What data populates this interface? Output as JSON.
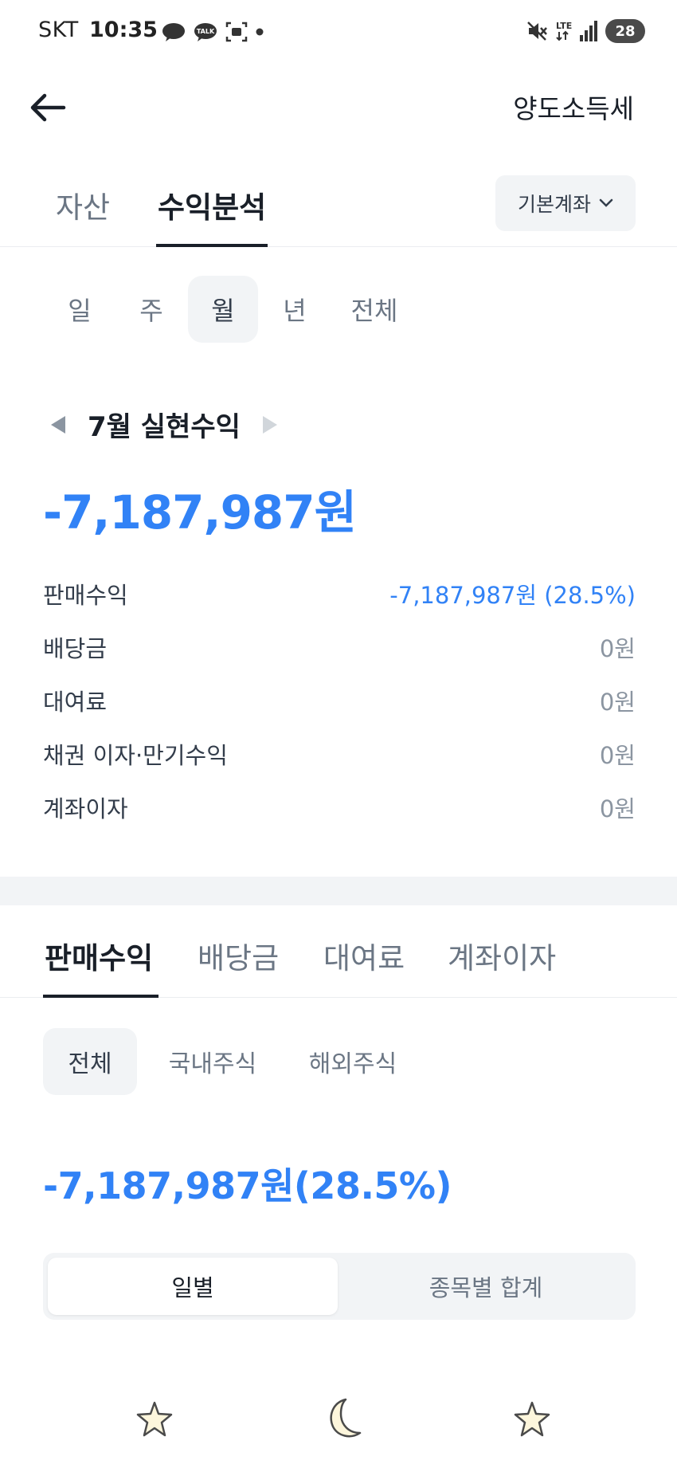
{
  "status_bar": {
    "carrier": "SKT",
    "time": "10:35",
    "battery": "28",
    "network": "LTE"
  },
  "header": {
    "title": "양도소득세"
  },
  "main_tabs": {
    "items": [
      {
        "label": "자산"
      },
      {
        "label": "수익분석"
      }
    ],
    "account_button": "기본계좌"
  },
  "period_tabs": {
    "items": [
      {
        "label": "일"
      },
      {
        "label": "주"
      },
      {
        "label": "월"
      },
      {
        "label": "년"
      },
      {
        "label": "전체"
      }
    ],
    "selected": "월"
  },
  "realized": {
    "title": "7월 실현수익",
    "total": "-7,187,987원",
    "rows": [
      {
        "label": "판매수익",
        "value": "-7,187,987원 (28.5%)"
      },
      {
        "label": "배당금",
        "value": "0원"
      },
      {
        "label": "대여료",
        "value": "0원"
      },
      {
        "label": "채권 이자·만기수익",
        "value": "0원"
      },
      {
        "label": "계좌이자",
        "value": "0원"
      }
    ]
  },
  "lower_tabs": {
    "items": [
      {
        "label": "판매수익"
      },
      {
        "label": "배당금"
      },
      {
        "label": "대여료"
      },
      {
        "label": "계좌이자"
      }
    ],
    "selected": "판매수익"
  },
  "market_filter": {
    "items": [
      {
        "label": "전체"
      },
      {
        "label": "국내주식"
      },
      {
        "label": "해외주식"
      }
    ],
    "selected": "전체"
  },
  "sales_summary": {
    "amount": "-7,187,987원(28.5%)"
  },
  "view_toggle": {
    "items": [
      {
        "label": "일별"
      },
      {
        "label": "종목별 합계"
      }
    ],
    "selected": "일별"
  },
  "colors": {
    "accent_blue": "#3182f6",
    "text_primary": "#191f28",
    "text_secondary": "#6b7684",
    "muted_bg": "#f2f4f6"
  }
}
